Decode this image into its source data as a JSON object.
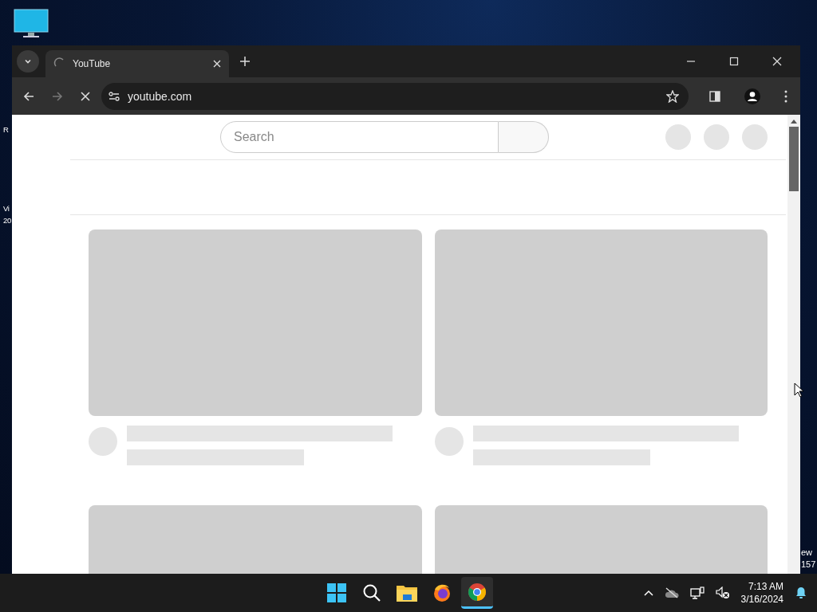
{
  "desktop": {
    "left_label_fragments": [
      "R",
      "Vi\n20"
    ],
    "right_label_fragments": [
      "ew\n157"
    ]
  },
  "browser": {
    "tabs": [
      {
        "title": "YouTube",
        "selected": true,
        "loading": true
      }
    ],
    "address": "youtube.com",
    "loading": true
  },
  "page": {
    "search": {
      "placeholder": "Search"
    },
    "feed": [
      {
        "kind": "placeholder"
      },
      {
        "kind": "placeholder"
      },
      {
        "kind": "thumbnail_only"
      },
      {
        "kind": "thumbnail_only"
      }
    ]
  },
  "taskbar": {
    "apps": [
      {
        "kind": "start",
        "selected": false
      },
      {
        "kind": "search",
        "selected": false
      },
      {
        "kind": "files",
        "selected": false
      },
      {
        "kind": "firefox",
        "selected": false
      },
      {
        "kind": "chrome",
        "selected": true
      }
    ],
    "clock": {
      "time": "7:13 AM",
      "date": "3/16/2024"
    }
  }
}
